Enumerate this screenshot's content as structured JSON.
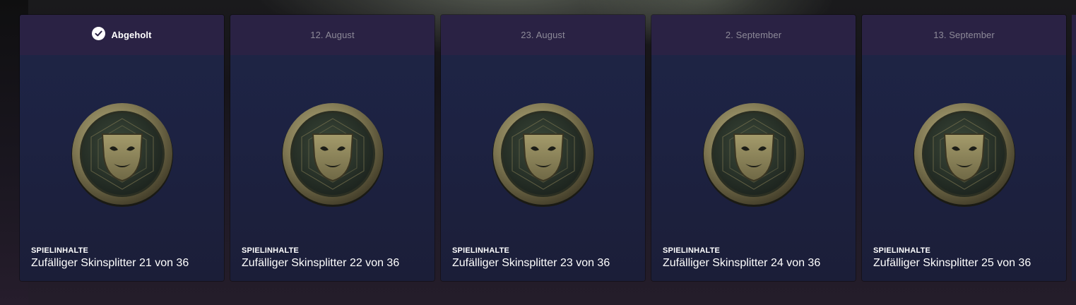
{
  "cards": [
    {
      "status": "Abgeholt",
      "claimed": true,
      "category": "SPIELINHALTE",
      "title": "Zufälliger Skinsplitter 21 von 36",
      "icon": "mask-token-icon"
    },
    {
      "status": "12. August",
      "claimed": false,
      "category": "SPIELINHALTE",
      "title": "Zufälliger Skinsplitter 22 von 36",
      "icon": "mask-token-icon"
    },
    {
      "status": "23. August",
      "claimed": false,
      "category": "SPIELINHALTE",
      "title": "Zufälliger Skinsplitter 23 von 36",
      "icon": "mask-token-icon"
    },
    {
      "status": "2. September",
      "claimed": false,
      "category": "SPIELINHALTE",
      "title": "Zufälliger Skinsplitter 24 von 36",
      "icon": "mask-token-icon"
    },
    {
      "status": "13. September",
      "claimed": false,
      "category": "SPIELINHALTE",
      "title": "Zufälliger Skinsplitter 25 von 36",
      "icon": "mask-token-icon"
    }
  ],
  "colors": {
    "header_bg": "#2a2244",
    "card_bg": "#1e2546",
    "date_text": "#8d8a98",
    "claimed_text": "#ffffff",
    "coin_gold": "#8f875e"
  }
}
